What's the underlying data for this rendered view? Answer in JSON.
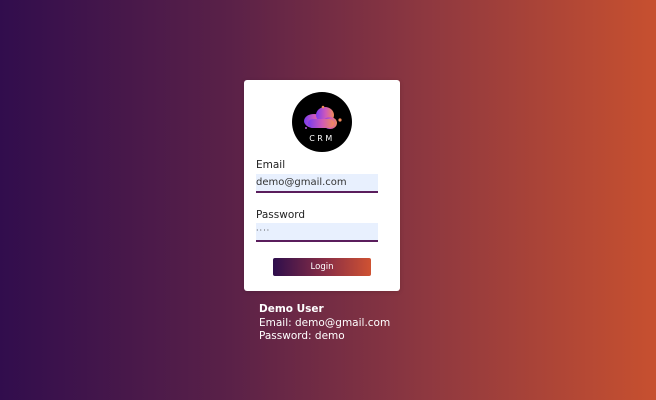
{
  "logo": {
    "text": "CRM",
    "icon": "cloud-icon"
  },
  "form": {
    "email_label": "Email",
    "email_value": "demo@gmail.com",
    "password_label": "Password",
    "password_value": "····",
    "login_label": "Login"
  },
  "demo": {
    "title": "Demo User",
    "email_line": "Email: demo@gmail.com",
    "password_line": "Password: demo"
  },
  "colors": {
    "gradient_start": "#310d4d",
    "gradient_end": "#c7502f",
    "field_underline": "#5a1d5c",
    "field_background": "#e8f0fe"
  }
}
